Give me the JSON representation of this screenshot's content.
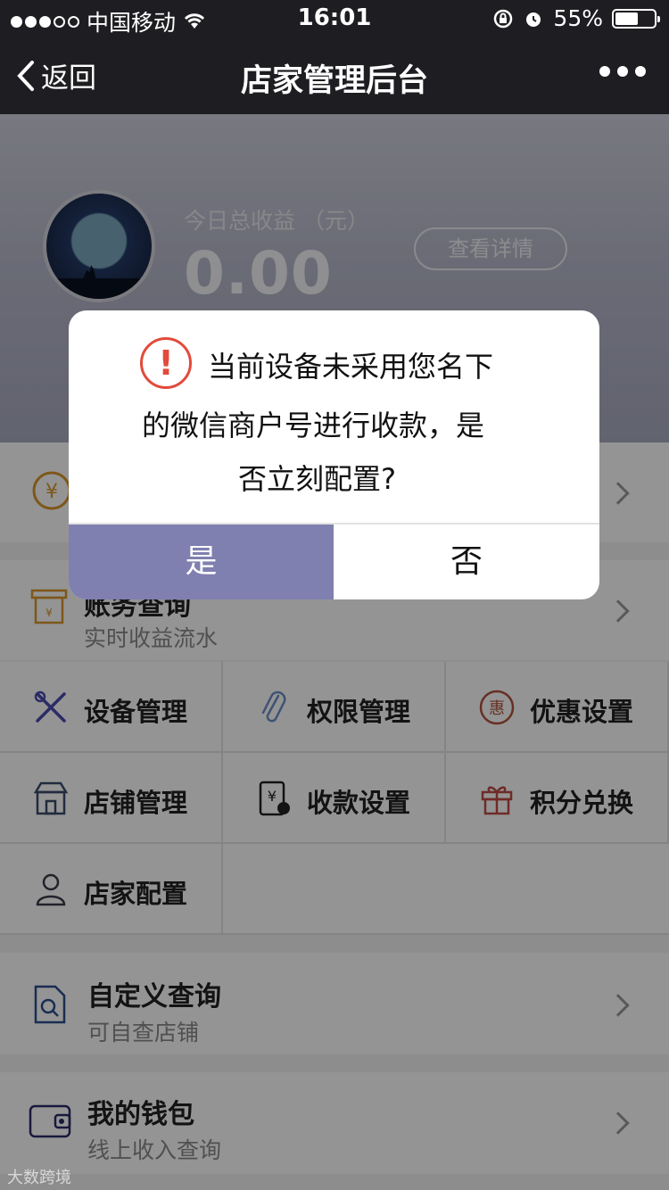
{
  "status_bar": {
    "carrier": "中国移动",
    "time": "16:01",
    "battery": "55%"
  },
  "nav": {
    "back_label": "返回",
    "title": "店家管理后台"
  },
  "header": {
    "earnings_label": "今日总收益 （元）",
    "earnings_value": "0.00",
    "detail_button": "查看详情"
  },
  "rows": {
    "statements": {
      "title": "账务查询",
      "subtitle": "实时收益流水"
    },
    "custom_query": {
      "title": "自定义查询",
      "subtitle": "可自查店铺"
    },
    "wallet": {
      "title": "我的钱包",
      "subtitle": "线上收入查询"
    }
  },
  "grid": {
    "items": [
      {
        "label": "设备管理",
        "icon": "tools-icon"
      },
      {
        "label": "权限管理",
        "icon": "paperclip-icon"
      },
      {
        "label": "优惠设置",
        "icon": "discount-icon"
      },
      {
        "label": "店铺管理",
        "icon": "store-icon"
      },
      {
        "label": "收款设置",
        "icon": "payment-icon"
      },
      {
        "label": "积分兑换",
        "icon": "gift-icon"
      },
      {
        "label": "店家配置",
        "icon": "user-icon"
      }
    ]
  },
  "dialog": {
    "line1": "当前设备未采用您名下",
    "line2": "的微信商户号进行收款，是",
    "line3": "否立刻配置?",
    "yes_label": "是",
    "no_label": "否"
  },
  "colors": {
    "accent": "#7f7fb0",
    "warning": "#e34a3b",
    "nav_bg": "#1e1e22"
  },
  "watermark": "大数跨境"
}
